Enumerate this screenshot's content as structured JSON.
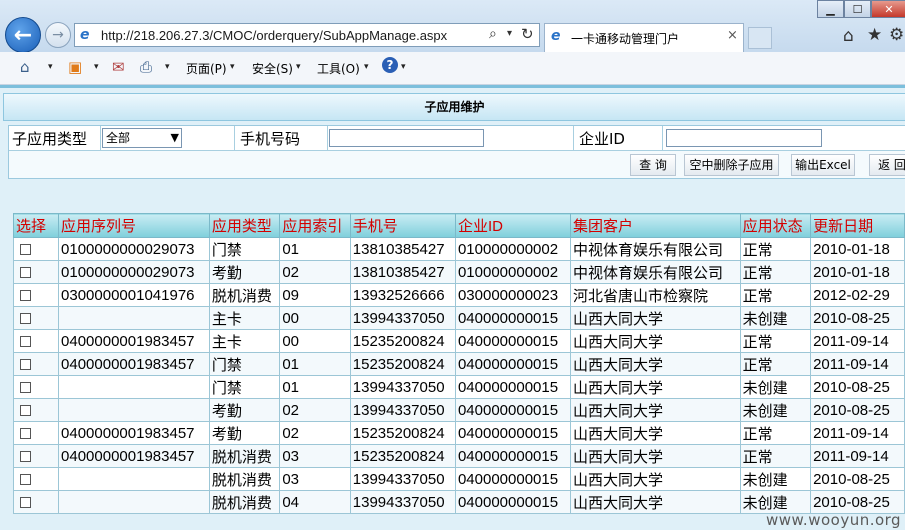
{
  "browser": {
    "url": "http://218.206.27.3/CMOC/orderquery/SubAppManage.aspx",
    "tab_title": "一卡通移动管理门户",
    "tab_close": "×",
    "window_buttons": {
      "minimize": "▁",
      "maximize": "☐",
      "close": "✕"
    },
    "icons": {
      "back": "←",
      "forward": "→",
      "search": "⌕",
      "dropdown": "▾",
      "refresh": "↻",
      "home": "⌂",
      "favorites": "★",
      "tools": "⚙",
      "page": "e"
    }
  },
  "command_bar": {
    "page_label": "页面(P)",
    "safety_label": "安全(S)",
    "tools_label": "工具(O)",
    "help_icon": "?"
  },
  "panel": {
    "title": "子应用维护"
  },
  "filter": {
    "type_label": "子应用类型",
    "type_selected": "全部",
    "phone_label": "手机号码",
    "phone_value": "",
    "enterprise_label": "企业ID",
    "enterprise_value": ""
  },
  "actions": {
    "query": "查 询",
    "delete_empty": "空中删除子应用",
    "export": "输出Excel",
    "back": "返 回"
  },
  "table": {
    "columns": [
      "选择",
      "应用序列号",
      "应用类型",
      "应用索引",
      "手机号",
      "企业ID",
      "集团客户",
      "应用状态",
      "更新日期"
    ],
    "rows": [
      [
        "0100000000029073",
        "门禁",
        "01",
        "13810385427",
        "010000000002",
        "中视体育娱乐有限公司",
        "正常",
        "2010-01-18"
      ],
      [
        "0100000000029073",
        "考勤",
        "02",
        "13810385427",
        "010000000002",
        "中视体育娱乐有限公司",
        "正常",
        "2010-01-18"
      ],
      [
        "0300000001041976",
        "脱机消费",
        "09",
        "13932526666",
        "030000000023",
        "河北省唐山市检察院",
        "正常",
        "2012-02-29"
      ],
      [
        "",
        "主卡",
        "00",
        "13994337050",
        "040000000015",
        "山西大同大学",
        "未创建",
        "2010-08-25"
      ],
      [
        "0400000001983457",
        "主卡",
        "00",
        "15235200824",
        "040000000015",
        "山西大同大学",
        "正常",
        "2011-09-14"
      ],
      [
        "0400000001983457",
        "门禁",
        "01",
        "15235200824",
        "040000000015",
        "山西大同大学",
        "正常",
        "2011-09-14"
      ],
      [
        "",
        "门禁",
        "01",
        "13994337050",
        "040000000015",
        "山西大同大学",
        "未创建",
        "2010-08-25"
      ],
      [
        "",
        "考勤",
        "02",
        "13994337050",
        "040000000015",
        "山西大同大学",
        "未创建",
        "2010-08-25"
      ],
      [
        "0400000001983457",
        "考勤",
        "02",
        "15235200824",
        "040000000015",
        "山西大同大学",
        "正常",
        "2011-09-14"
      ],
      [
        "0400000001983457",
        "脱机消费",
        "03",
        "15235200824",
        "040000000015",
        "山西大同大学",
        "正常",
        "2011-09-14"
      ],
      [
        "",
        "脱机消费",
        "03",
        "13994337050",
        "040000000015",
        "山西大同大学",
        "未创建",
        "2010-08-25"
      ],
      [
        "",
        "脱机消费",
        "04",
        "13994337050",
        "040000000015",
        "山西大同大学",
        "未创建",
        "2010-08-25"
      ]
    ]
  },
  "watermark": "www.wooyun.org"
}
